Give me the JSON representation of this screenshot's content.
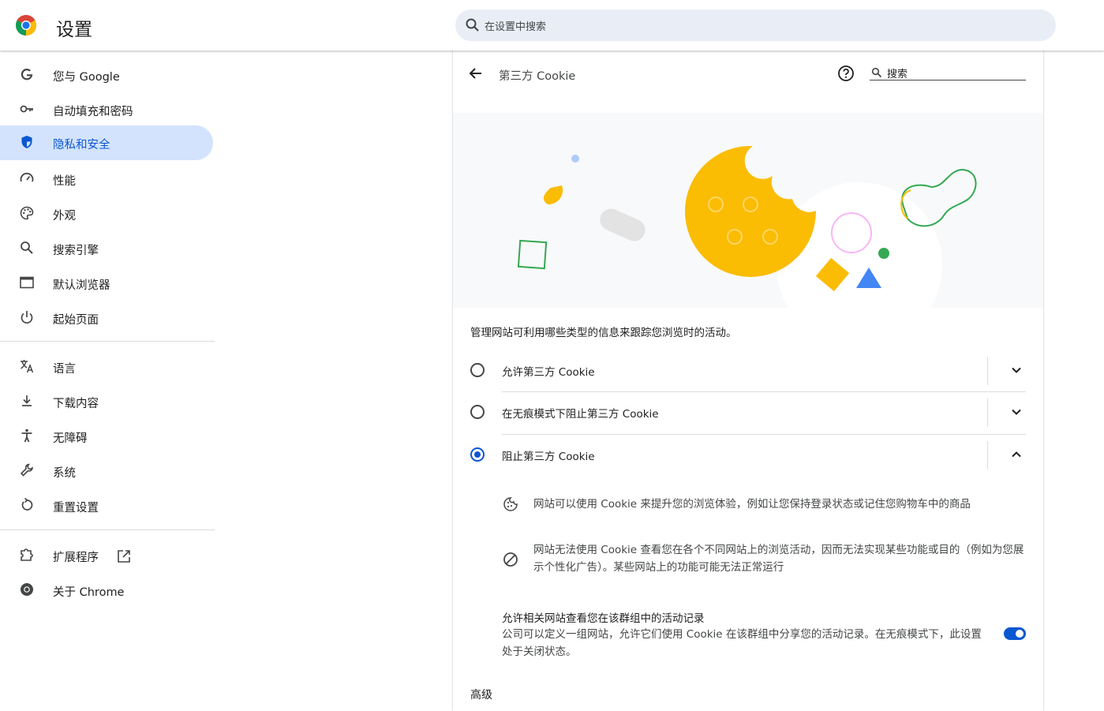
{
  "header": {
    "app_title": "设置",
    "search_placeholder": "在设置中搜索"
  },
  "sidebar": {
    "items": [
      {
        "label": "您与 Google",
        "icon": "google-g-icon"
      },
      {
        "label": "自动填充和密码",
        "icon": "key-icon"
      },
      {
        "label": "隐私和安全",
        "icon": "shield-icon",
        "active": true
      },
      {
        "label": "性能",
        "icon": "speedometer-icon"
      },
      {
        "label": "外观",
        "icon": "palette-icon"
      },
      {
        "label": "搜索引擎",
        "icon": "search-icon"
      },
      {
        "label": "默认浏览器",
        "icon": "browser-window-icon"
      },
      {
        "label": "起始页面",
        "icon": "power-icon"
      },
      {
        "label": "语言",
        "icon": "translate-icon"
      },
      {
        "label": "下载内容",
        "icon": "download-icon"
      },
      {
        "label": "无障碍",
        "icon": "accessibility-icon"
      },
      {
        "label": "系统",
        "icon": "wrench-icon"
      },
      {
        "label": "重置设置",
        "icon": "reset-icon"
      },
      {
        "label": "扩展程序",
        "icon": "puzzle-icon"
      },
      {
        "label": "关于 Chrome",
        "icon": "chrome-icon"
      }
    ]
  },
  "main": {
    "page_title": "第三方 Cookie",
    "search_placeholder": "搜索",
    "description": "管理网站可利用哪些类型的信息来跟踪您浏览时的活动。",
    "options": [
      {
        "label": "允许第三方 Cookie",
        "selected": false,
        "expanded": false
      },
      {
        "label": "在无痕模式下阻止第三方 Cookie",
        "selected": false,
        "expanded": false
      },
      {
        "label": "阻止第三方 Cookie",
        "selected": true,
        "expanded": true
      }
    ],
    "details": [
      {
        "text": "网站可以使用 Cookie 来提升您的浏览体验，例如让您保持登录状态或记住您购物车中的商品",
        "icon": "cookie-icon"
      },
      {
        "text": "网站无法使用 Cookie 查看您在各个不同网站上的浏览活动，因而无法实现某些功能或目的（例如为您展示个性化广告）。某些网站上的功能可能无法正常运行",
        "icon": "block-icon"
      }
    ],
    "related_sites": {
      "title": "允许相关网站查看您在该群组中的活动记录",
      "description": "公司可以定义一组网站，允许它们使用 Cookie 在该群组中分享您的活动记录。在无痕模式下，此设置处于关闭状态。",
      "enabled": true
    },
    "advanced_label": "高级"
  },
  "colors": {
    "accent": "#0b57d0",
    "active_nav_bg": "#d3e3fd",
    "search_bg": "#e9eef6",
    "cookie_yellow": "#fbbc04"
  }
}
